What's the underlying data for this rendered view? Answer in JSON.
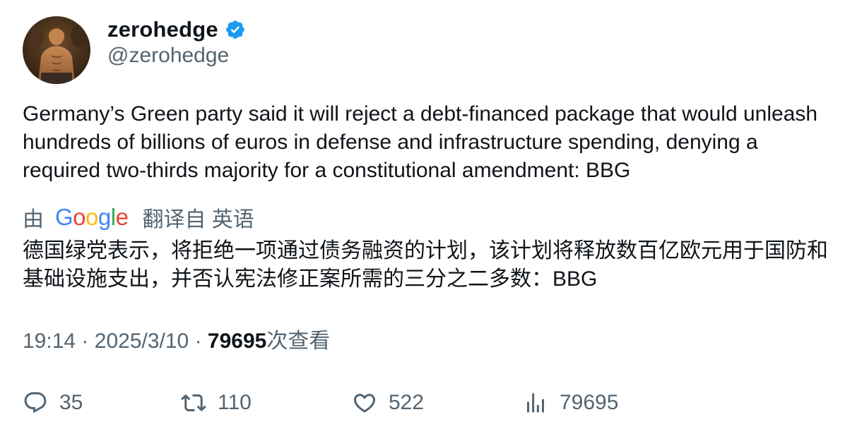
{
  "author": {
    "display_name": "zerohedge",
    "handle": "@zerohedge",
    "verified": true,
    "avatar_icon": "avatar-photo"
  },
  "tweet": {
    "text": "Germany’s Green party said it will reject a debt-financed package that would unleash hundreds of billions of euros in defense and infrastructure spending, denying a required two-thirds majority for a constitutional amendment: BBG"
  },
  "translation": {
    "by_label": "由",
    "provider": "Google",
    "provider_letters": [
      "G",
      "o",
      "o",
      "g",
      "l",
      "e"
    ],
    "provider_colors": [
      "#4285F4",
      "#EA4335",
      "#FBBC05",
      "#4285F4",
      "#34A853",
      "#EA4335"
    ],
    "translated_from_label": "翻译自 英语",
    "text": "德国绿党表示，将拒绝一项通过债务融资的计划，该计划将释放数百亿欧元用于国防和基础设施支出，并否认宪法修正案所需的三分之二多数：BBG"
  },
  "meta": {
    "time": "19:14",
    "separator": "·",
    "date": "2025/3/10",
    "views_count": "79695",
    "views_label": "次查看"
  },
  "actions": {
    "replies": "35",
    "retweets": "110",
    "likes": "522",
    "views": "79695"
  },
  "colors": {
    "text_primary": "#0f1419",
    "text_secondary": "#536471",
    "verified_blue": "#1d9bf0"
  }
}
